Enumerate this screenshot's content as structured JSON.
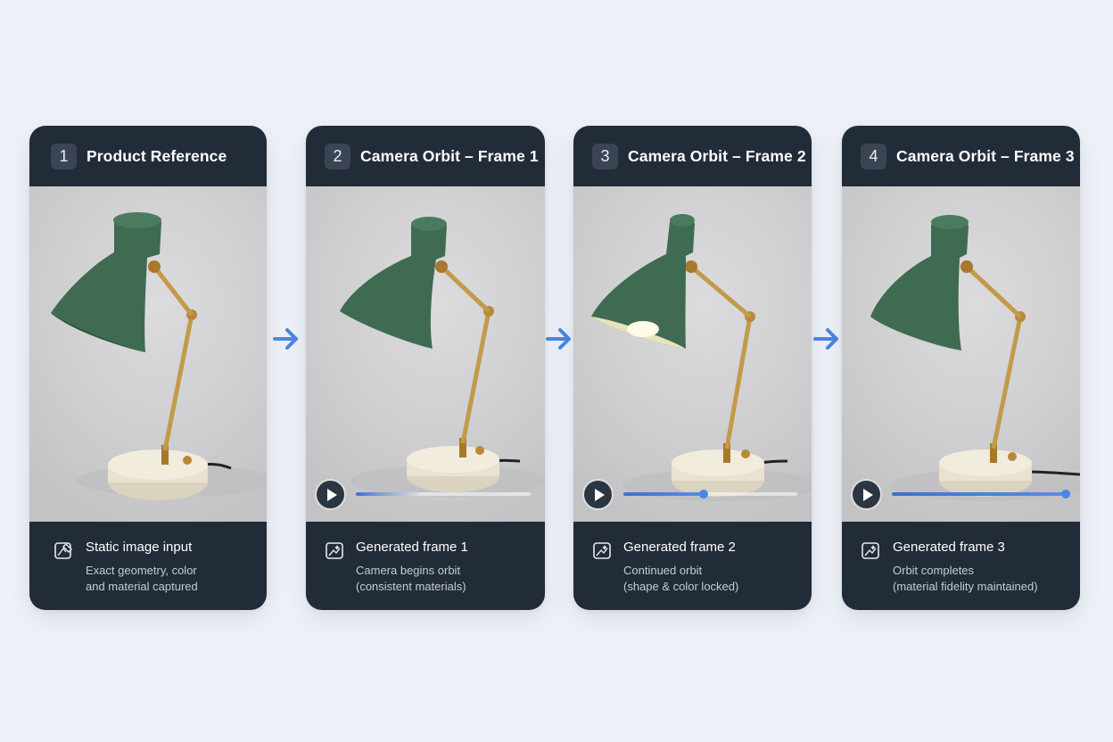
{
  "cards": [
    {
      "step": "1",
      "title": "Product Reference",
      "footer_title": "Static image input",
      "footer_line1": "Exact geometry, color",
      "footer_line2": "and material captured",
      "icon": "image-edit-icon"
    },
    {
      "step": "2",
      "title": "Camera Orbit – Frame 1",
      "footer_title": "Generated frame 1",
      "footer_line1": "Camera begins orbit",
      "footer_line2": "(consistent materials)",
      "icon": "sparkle-image-icon",
      "progress": 0.0
    },
    {
      "step": "3",
      "title": "Camera Orbit – Frame 2",
      "footer_title": "Generated frame 2",
      "footer_line1": "Continued orbit",
      "footer_line2": "(shape & color locked)",
      "icon": "sparkle-image-icon",
      "progress": 0.46
    },
    {
      "step": "4",
      "title": "Camera Orbit – Frame 3",
      "footer_title": "Generated frame 3",
      "footer_line1": "Orbit completes",
      "footer_line2": "(material fidelity maintained)",
      "icon": "sparkle-image-icon",
      "progress": 1.0
    }
  ],
  "colors": {
    "background": "#eef2f8",
    "card": "#222b38",
    "accent": "#4a86e6",
    "lamp_shade": "#3f6b52",
    "lamp_brass": "#b8893a",
    "lamp_base": "#ece6d2"
  }
}
